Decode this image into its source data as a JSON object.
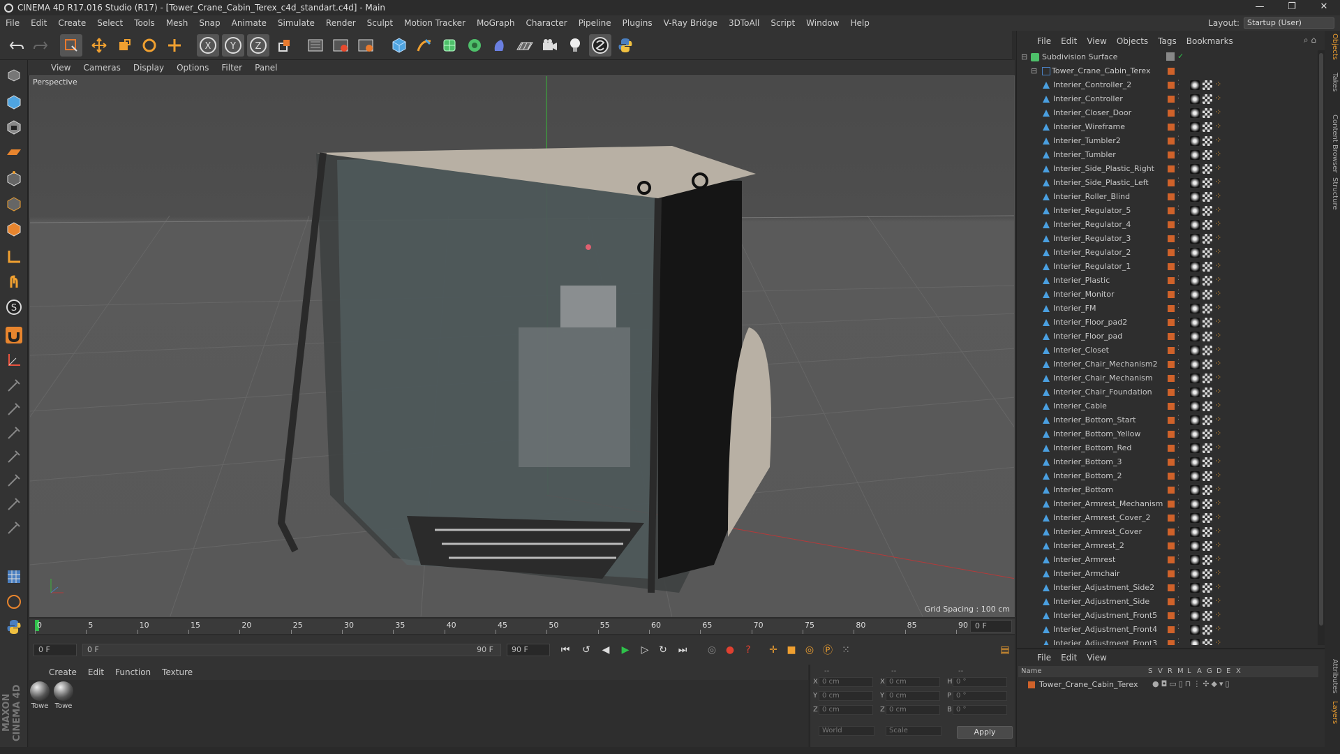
{
  "window": {
    "title": "CINEMA 4D R17.016 Studio (R17) - [Tower_Crane_Cabin_Terex_c4d_standart.c4d] - Main",
    "controls": [
      "—",
      "❐",
      "✕"
    ]
  },
  "menubar": {
    "items": [
      "File",
      "Edit",
      "Create",
      "Select",
      "Tools",
      "Mesh",
      "Snap",
      "Animate",
      "Simulate",
      "Render",
      "Sculpt",
      "Motion Tracker",
      "MoGraph",
      "Character",
      "Pipeline",
      "Plugins",
      "V-Ray Bridge",
      "3DToAll",
      "Script",
      "Window",
      "Help"
    ],
    "layout_label": "Layout:",
    "layout_value": "Startup (User)"
  },
  "viewport": {
    "menu": [
      "View",
      "Cameras",
      "Display",
      "Options",
      "Filter",
      "Panel"
    ],
    "camera_label": "Perspective",
    "grid_spacing": "Grid Spacing : 100 cm"
  },
  "timeline": {
    "ticks": [
      "0",
      "5",
      "10",
      "15",
      "20",
      "25",
      "30",
      "35",
      "40",
      "45",
      "50",
      "55",
      "60",
      "65",
      "70",
      "75",
      "80",
      "85",
      "90"
    ],
    "frame_end_display": "0 F"
  },
  "playback": {
    "current_frame": "0 F",
    "range_start": "0 F",
    "range_end": "90 F",
    "max_frame": "90 F"
  },
  "material_manager": {
    "menu": [
      "Create",
      "Edit",
      "Function",
      "Texture"
    ],
    "materials": [
      "Towe",
      "Towe"
    ]
  },
  "coordinates": {
    "rows": [
      {
        "a": "X",
        "av": "0 cm",
        "b": "X",
        "bv": "0 cm",
        "c": "H",
        "cv": "0 °"
      },
      {
        "a": "Y",
        "av": "0 cm",
        "b": "Y",
        "bv": "0 cm",
        "c": "P",
        "cv": "0 °"
      },
      {
        "a": "Z",
        "av": "0 cm",
        "b": "Z",
        "bv": "0 cm",
        "c": "B",
        "cv": "0 °"
      }
    ],
    "header": [
      "--",
      "--",
      "--"
    ],
    "mode": "World",
    "transform": "Scale",
    "apply": "Apply"
  },
  "object_manager": {
    "menu": [
      "File",
      "Edit",
      "View",
      "Objects",
      "Tags",
      "Bookmarks"
    ],
    "root": "Subdivision Surface",
    "group": "Tower_Crane_Cabin_Terex",
    "objects": [
      "Interier_Controller_2",
      "Interier_Controller",
      "Interier_Closer_Door",
      "Interier_Wireframe",
      "Interier_Tumbler2",
      "Interier_Tumbler",
      "Interier_Side_Plastic_Right",
      "Interier_Side_Plastic_Left",
      "Interier_Roller_Blind",
      "Interier_Regulator_5",
      "Interier_Regulator_4",
      "Interier_Regulator_3",
      "Interier_Regulator_2",
      "Interier_Regulator_1",
      "Interier_Plastic",
      "Interier_Monitor",
      "Interier_FM",
      "Interier_Floor_pad2",
      "Interier_Floor_pad",
      "Interier_Closet",
      "Interier_Chair_Mechanism2",
      "Interier_Chair_Mechanism",
      "Interier_Chair_Foundation",
      "Interier_Cable",
      "Interier_Bottom_Start",
      "Interier_Bottom_Yellow",
      "Interier_Bottom_Red",
      "Interier_Bottom_3",
      "Interier_Bottom_2",
      "Interier_Bottom",
      "Interier_Armrest_Mechanism",
      "Interier_Armrest_Cover_2",
      "Interier_Armrest_Cover",
      "Interier_Armrest_2",
      "Interier_Armrest",
      "Interier_Armchair",
      "Interier_Adjustment_Side2",
      "Interier_Adjustment_Side",
      "Interier_Adjustment_Front5",
      "Interier_Adjustment_Front4",
      "Interier_Adjustment_Front3"
    ]
  },
  "attribute_manager": {
    "menu": [
      "File",
      "Edit",
      "View"
    ],
    "columns": [
      "Name",
      "S",
      "V",
      "R",
      "M",
      "L",
      "A",
      "G",
      "D",
      "E",
      "X"
    ],
    "row_name": "Tower_Crane_Cabin_Terex"
  },
  "side_tabs": [
    "Objects",
    "Takes",
    "Content Browser",
    "Structure",
    "Attributes",
    "Layers"
  ],
  "brand": "MAXON CINEMA 4D",
  "colors": {
    "accent_orange": "#d0622a",
    "highlight_blue": "#4a7fc0",
    "play_green": "#2ec14a"
  }
}
